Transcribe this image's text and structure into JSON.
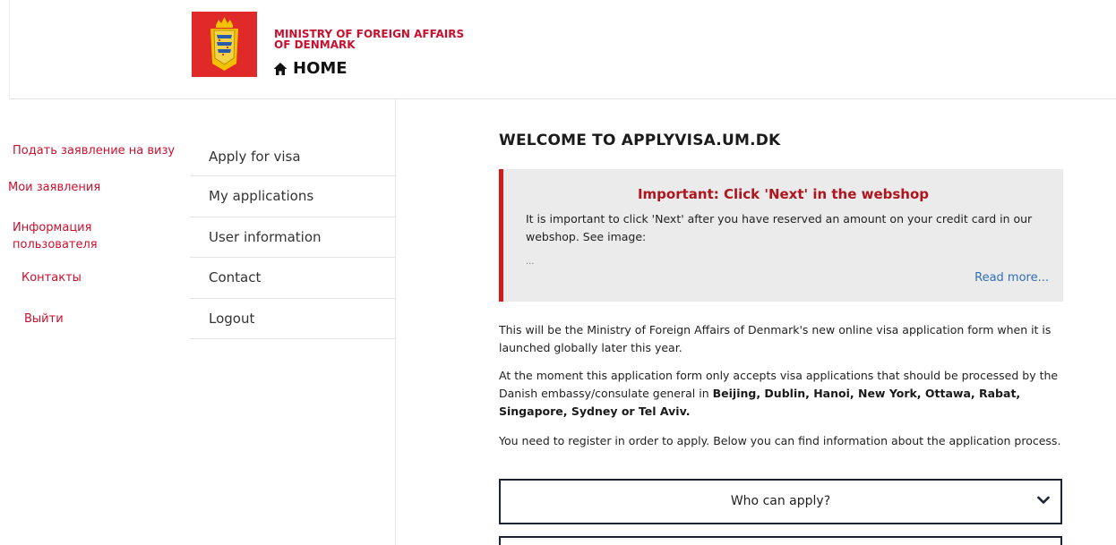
{
  "header": {
    "ministry_line1": "MINISTRY OF FOREIGN AFFAIRS",
    "ministry_line2": "OF DENMARK",
    "home_label": "HOME",
    "logo_color": "#e02a2a"
  },
  "ru_nav": [
    {
      "label": "Подать заявление на визу"
    },
    {
      "label": "Мои заявления"
    },
    {
      "label": "Информация"
    },
    {
      "label": "пользователя"
    },
    {
      "label": "Контакты"
    },
    {
      "label": "Выйти"
    }
  ],
  "en_nav": [
    {
      "label": "Apply for visa"
    },
    {
      "label": "My applications"
    },
    {
      "label": "User information"
    },
    {
      "label": "Contact"
    },
    {
      "label": "Logout"
    }
  ],
  "main": {
    "title": "WELCOME TO APPLYVISA.UM.DK",
    "notice": {
      "title": "Important: Click 'Next' in the webshop",
      "text": "It is important to click 'Next' after you have reserved an amount on your credit card in our webshop. See image:",
      "dots": "...",
      "read_more": "Read more..."
    },
    "p1": "This will be the Ministry of Foreign Affairs of Denmark's new online visa application form when it is launched globally later this year.",
    "p2_intro": "At the moment this application form only accepts visa applications that should be processed by the Danish embassy/consulate general in ",
    "p2_cities": "Beijing, Dublin, Hanoi, New York, Ottawa, Rabat, Singapore, Sydney or Tel Aviv.",
    "p3": "You need to register in order to apply. Below you can find information about the application process.",
    "accordion": [
      {
        "label": "Who can apply?"
      }
    ]
  },
  "colors": {
    "accent_red": "#c8102e",
    "notice_border": "#d31a1a",
    "link_blue": "#2e6fb8",
    "accordion_border": "#1a2432"
  }
}
